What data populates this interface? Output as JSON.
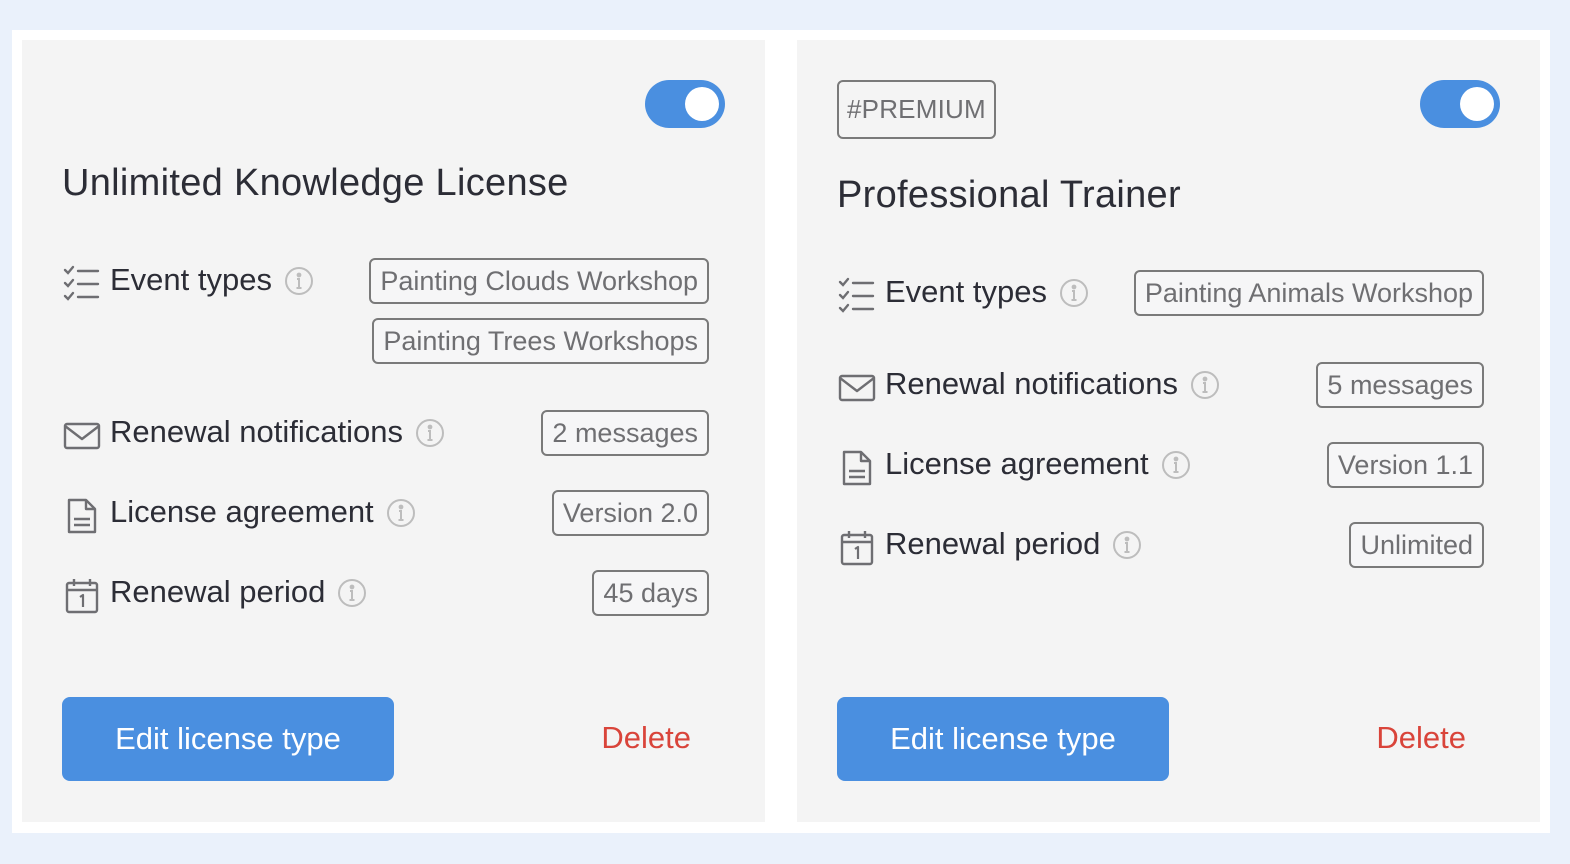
{
  "colors": {
    "page_background": "#eaf1fb",
    "card_background": "#f4f4f4",
    "accent": "#4a8fe0",
    "danger": "#d9443a"
  },
  "cards": [
    {
      "enabled": true,
      "tag": null,
      "title": "Unlimited Knowledge License",
      "rows": {
        "event_types": {
          "label": "Event types",
          "icon": "checklist-icon",
          "values": [
            "Painting Clouds Workshop",
            "Painting Trees Workshops"
          ]
        },
        "renewal_notifications": {
          "label": "Renewal notifications",
          "icon": "envelope-icon",
          "value": "2 messages"
        },
        "license_agreement": {
          "label": "License agreement",
          "icon": "document-icon",
          "value": "Version 2.0"
        },
        "renewal_period": {
          "label": "Renewal period",
          "icon": "calendar-icon",
          "value": "45 days"
        }
      },
      "edit_label": "Edit license type",
      "delete_label": "Delete"
    },
    {
      "enabled": true,
      "tag": "#PREMIUM",
      "title": "Professional Trainer",
      "rows": {
        "event_types": {
          "label": "Event types",
          "icon": "checklist-icon",
          "values": [
            "Painting Animals Workshop"
          ]
        },
        "renewal_notifications": {
          "label": "Renewal notifications",
          "icon": "envelope-icon",
          "value": "5 messages"
        },
        "license_agreement": {
          "label": "License agreement",
          "icon": "document-icon",
          "value": "Version 1.1"
        },
        "renewal_period": {
          "label": "Renewal period",
          "icon": "calendar-icon",
          "value": "Unlimited"
        }
      },
      "edit_label": "Edit license type",
      "delete_label": "Delete"
    }
  ]
}
